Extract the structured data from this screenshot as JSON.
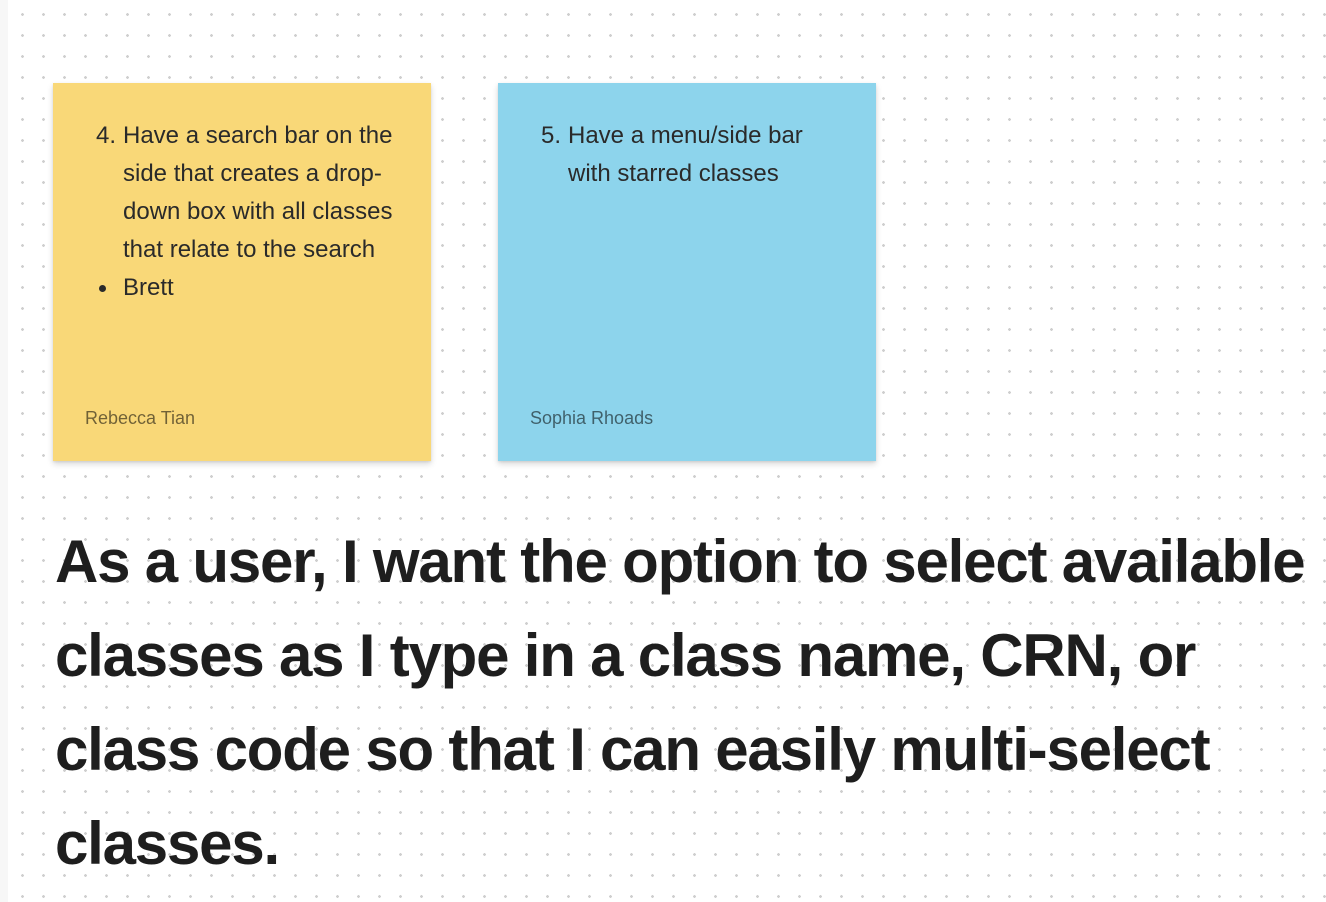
{
  "canvas": {
    "background": "#ffffff",
    "dot_color": "#cfcfcf"
  },
  "sticky_notes": [
    {
      "color": "#f9d878",
      "number": "4.",
      "text": "Have a search bar on the side that creates a drop-down box with all classes that relate to the search",
      "bullets": [
        "Brett"
      ],
      "author": "Rebecca Tian"
    },
    {
      "color": "#8dd4ec",
      "number": "5.",
      "text": "Have a menu/side bar with starred classes",
      "author": "Sophia Rhoads"
    }
  ],
  "user_story": {
    "text": "As a user, I want the option to select available classes as I type in a class name, CRN, or class code so that I can easily multi-select classes."
  }
}
